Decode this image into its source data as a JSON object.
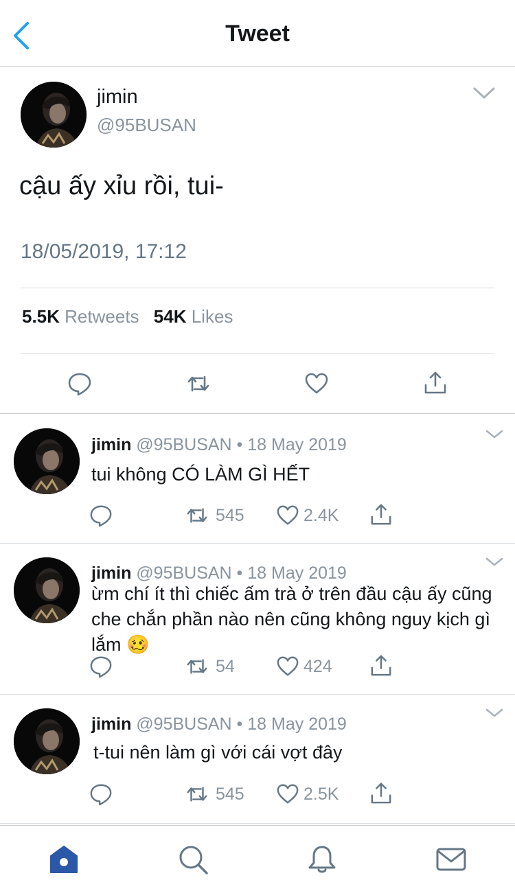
{
  "header": {
    "title": "Tweet"
  },
  "main_tweet": {
    "name": "jimin",
    "handle": "@95BUSAN",
    "text": "cậu ấy xỉu rồi, tui-",
    "timestamp": "18/05/2019, 17:12",
    "retweets_count": "5.5K",
    "retweets_label": "Retweets",
    "likes_count": "54K",
    "likes_label": "Likes"
  },
  "replies": [
    {
      "name": "jimin",
      "meta": "@95BUSAN • 18 May 2019",
      "text": "tui không CÓ LÀM GÌ HẾT",
      "retweets": "545",
      "likes": "2.4K"
    },
    {
      "name": "jimin",
      "meta": "@95BUSAN • 18 May 2019",
      "text": "ừm chí ít thì chiếc ấm trà ở trên đầu cậu ấy cũng che chắn phần nào nên cũng không nguy kịch gì lắm 🥴",
      "retweets": "54",
      "likes": "424"
    },
    {
      "name": "jimin",
      "meta": "@95BUSAN • 18 May 2019",
      "text": "t-tui nên làm gì với cái vợt đây",
      "retweets": "545",
      "likes": "2.5K"
    }
  ],
  "tabbar": {
    "items": [
      "home-icon",
      "search-icon",
      "bell-icon",
      "mail-icon"
    ],
    "active": "home-icon"
  },
  "colors": {
    "accent": "#1da1f2",
    "active_tab": "#2b58a7",
    "icon_gray": "#657786",
    "text_gray": "#8a949e"
  }
}
